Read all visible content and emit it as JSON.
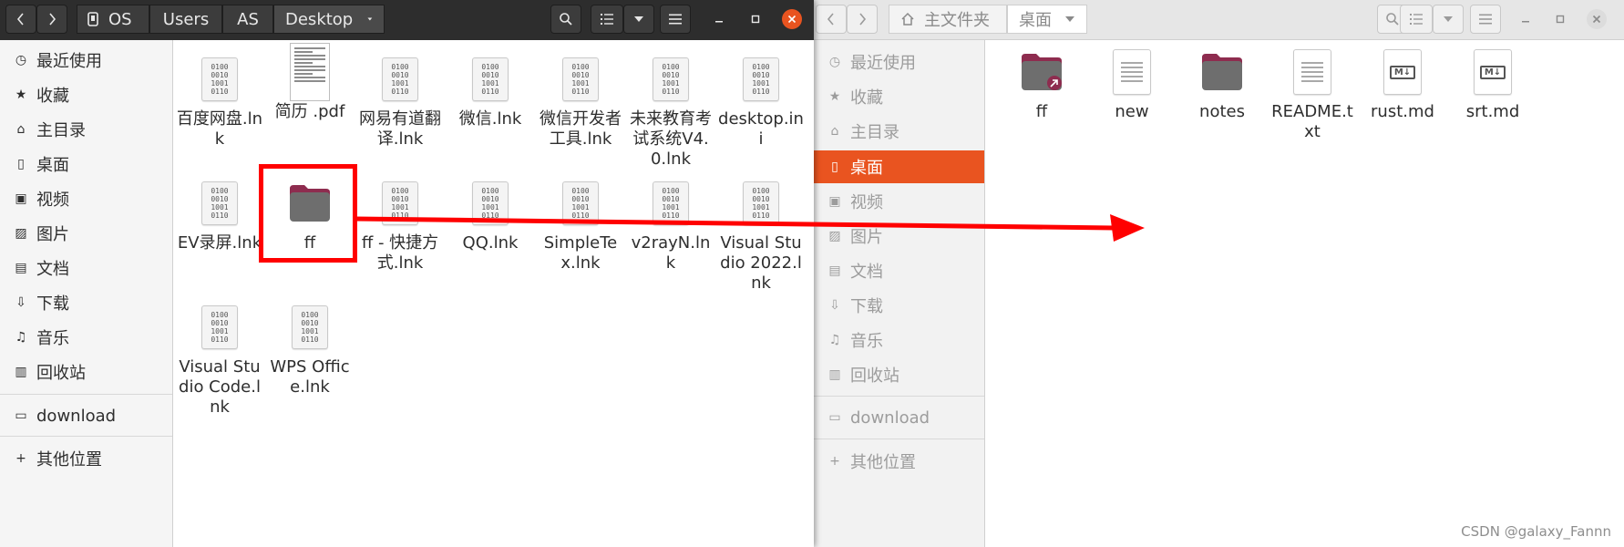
{
  "left_window": {
    "breadcrumb": [
      "OS",
      "Users",
      "AS",
      "Desktop"
    ],
    "sidebar": [
      {
        "label": "最近使用",
        "icon": "clock-icon",
        "glyph": "◷"
      },
      {
        "label": "收藏",
        "icon": "star-icon",
        "glyph": "★"
      },
      {
        "label": "主目录",
        "icon": "home-icon",
        "glyph": "⌂"
      },
      {
        "label": "桌面",
        "icon": "desktop-icon",
        "glyph": "▯"
      },
      {
        "label": "视频",
        "icon": "video-icon",
        "glyph": "▣"
      },
      {
        "label": "图片",
        "icon": "picture-icon",
        "glyph": "▨"
      },
      {
        "label": "文档",
        "icon": "document-icon",
        "glyph": "▤"
      },
      {
        "label": "下载",
        "icon": "download-icon",
        "glyph": "⇩"
      },
      {
        "label": "音乐",
        "icon": "music-icon",
        "glyph": "♫"
      },
      {
        "label": "回收站",
        "icon": "trash-icon",
        "glyph": "▥"
      },
      {
        "label": "download",
        "icon": "folder-icon",
        "glyph": "▭"
      },
      {
        "label": "其他位置",
        "icon": "plus-icon",
        "glyph": "+"
      }
    ],
    "files": [
      {
        "name": "百度网盘.lnk",
        "type": "binary"
      },
      {
        "name": "简历 .pdf",
        "type": "pdf"
      },
      {
        "name": "网易有道翻译.lnk",
        "type": "binary"
      },
      {
        "name": "微信.lnk",
        "type": "binary"
      },
      {
        "name": "微信开发者工具.lnk",
        "type": "binary"
      },
      {
        "name": "未来教育考试系统V4.0.lnk",
        "type": "binary"
      },
      {
        "name": "desktop.ini",
        "type": "binary"
      },
      {
        "name": "EV录屏.lnk",
        "type": "binary"
      },
      {
        "name": "ff",
        "type": "folder"
      },
      {
        "name": "ff - 快捷方式.lnk",
        "type": "binary"
      },
      {
        "name": "QQ.lnk",
        "type": "binary"
      },
      {
        "name": "SimpleTex.lnk",
        "type": "binary"
      },
      {
        "name": "v2rayN.lnk",
        "type": "binary"
      },
      {
        "name": "Visual Studio 2022.lnk",
        "type": "binary"
      },
      {
        "name": "Visual Studio Code.lnk",
        "type": "binary"
      },
      {
        "name": "WPS Office.lnk",
        "type": "binary"
      }
    ]
  },
  "right_window": {
    "breadcrumb": [
      "主文件夹",
      "桌面"
    ],
    "sidebar": [
      {
        "label": "最近使用",
        "icon": "clock-icon",
        "glyph": "◷"
      },
      {
        "label": "收藏",
        "icon": "star-icon",
        "glyph": "★"
      },
      {
        "label": "主目录",
        "icon": "home-icon",
        "glyph": "⌂"
      },
      {
        "label": "桌面",
        "icon": "desktop-icon",
        "glyph": "▯"
      },
      {
        "label": "视频",
        "icon": "video-icon",
        "glyph": "▣"
      },
      {
        "label": "图片",
        "icon": "picture-icon",
        "glyph": "▨"
      },
      {
        "label": "文档",
        "icon": "document-icon",
        "glyph": "▤"
      },
      {
        "label": "下载",
        "icon": "download-icon",
        "glyph": "⇩"
      },
      {
        "label": "音乐",
        "icon": "music-icon",
        "glyph": "♫"
      },
      {
        "label": "回收站",
        "icon": "trash-icon",
        "glyph": "▥"
      },
      {
        "label": "download",
        "icon": "folder-icon",
        "glyph": "▭"
      },
      {
        "label": "其他位置",
        "icon": "plus-icon",
        "glyph": "+"
      }
    ],
    "active_sidebar": "桌面",
    "files": [
      {
        "name": "ff",
        "type": "folder-link"
      },
      {
        "name": "new",
        "type": "text"
      },
      {
        "name": "notes",
        "type": "folder"
      },
      {
        "name": "README.txt",
        "type": "text"
      },
      {
        "name": "rust.md",
        "type": "markdown"
      },
      {
        "name": "srt.md",
        "type": "markdown"
      }
    ]
  },
  "binary_icon_text": [
    "0100",
    "0010",
    "1001",
    "0110"
  ],
  "markdown_icon_text": "M↓",
  "annotation": {
    "color": "#ff0000"
  },
  "colors": {
    "accent": "#e95420",
    "folder_top": "#8e2c4f",
    "folder_body": "#6e6e6e"
  },
  "watermark": "CSDN @galaxy_Fannn"
}
